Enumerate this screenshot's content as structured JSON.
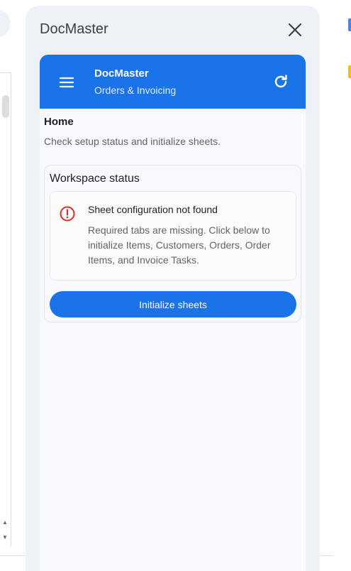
{
  "sidebar_panel": {
    "title": "DocMaster"
  },
  "addon": {
    "header": {
      "app_name": "DocMaster",
      "subtitle": "Orders & Invoicing",
      "menu_icon": "hamburger-menu-icon",
      "refresh_icon": "refresh-icon"
    },
    "page": {
      "title": "Home",
      "subtitle": "Check setup status and initialize sheets."
    },
    "workspace_status": {
      "title": "Workspace status",
      "alert": {
        "icon": "error-icon",
        "title": "Sheet configuration not found",
        "body": "Required tabs are missing. Click below to initialize Items, Customers, Orders, Order Items, and Invoice Tasks."
      },
      "button_label": "Initialize sheets"
    }
  },
  "colors": {
    "brand": "#1a73e8",
    "error": "#d93025",
    "panel_bg": "#eef2f7"
  }
}
